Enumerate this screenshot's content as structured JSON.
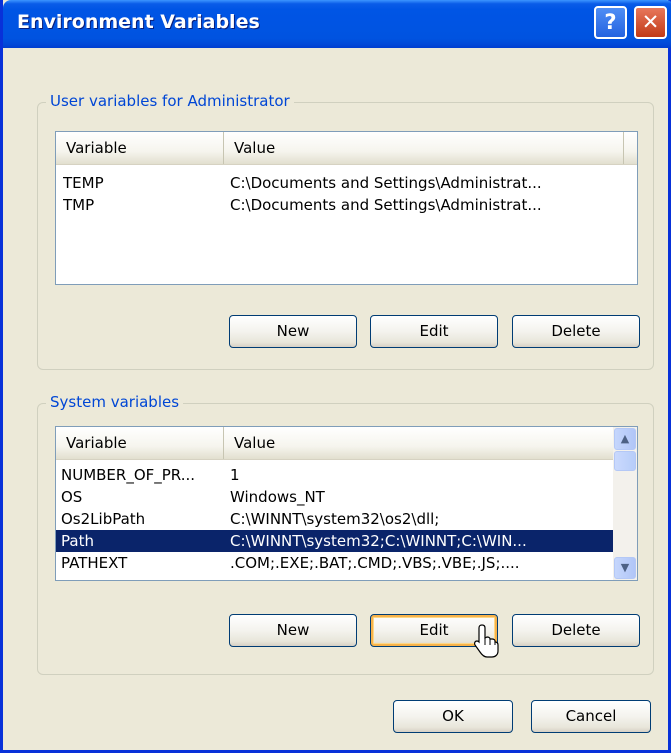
{
  "window": {
    "title": "Environment Variables"
  },
  "user_vars": {
    "legend": "User variables for Administrator",
    "columns": [
      "Variable",
      "Value"
    ],
    "rows": [
      {
        "name": "TEMP",
        "value": "C:\\Documents and Settings\\Administrat..."
      },
      {
        "name": "TMP",
        "value": "C:\\Documents and Settings\\Administrat..."
      }
    ],
    "buttons": {
      "new": "New",
      "edit": "Edit",
      "delete": "Delete"
    }
  },
  "system_vars": {
    "legend": "System variables",
    "columns": [
      "Variable",
      "Value"
    ],
    "rows": [
      {
        "name": "NUMBER_OF_PR...",
        "value": "1"
      },
      {
        "name": "OS",
        "value": "Windows_NT"
      },
      {
        "name": "Os2LibPath",
        "value": "C:\\WINNT\\system32\\os2\\dll;"
      },
      {
        "name": "Path",
        "value": "C:\\WINNT\\system32;C:\\WINNT;C:\\WIN..."
      },
      {
        "name": "PATHEXT",
        "value": ".COM;.EXE;.BAT;.CMD;.VBS;.VBE;.JS;...."
      }
    ],
    "selected_row": "Path",
    "buttons": {
      "new": "New",
      "edit": "Edit",
      "delete": "Delete"
    }
  },
  "dialog_buttons": {
    "ok": "OK",
    "cancel": "Cancel"
  },
  "icons": {
    "help": "?",
    "close": "✕",
    "scroll_up": "▲",
    "scroll_down": "▼"
  },
  "colors": {
    "titlebar": "#0054E3",
    "legend_text": "#0046D5",
    "selection": "#0A246A",
    "hot_button_glow": "#F8B34A"
  }
}
